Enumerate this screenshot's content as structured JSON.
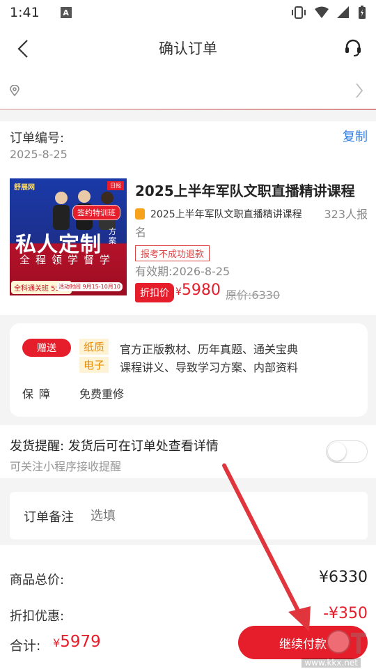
{
  "status_bar": {
    "time": "1:41",
    "notification": "A"
  },
  "nav": {
    "title": "确认订单"
  },
  "order": {
    "number_label": "订单编号:",
    "date": "2025-8-25",
    "copy_label": "复制"
  },
  "product": {
    "title": "2025上半年军队文职直播精讲课程",
    "name": "2025上半年军队文职直播精讲课程",
    "name_continued": "名",
    "enrolled": "323人报",
    "refund_tag": "报考不成功退款",
    "validity": "有效期:2026-8-25",
    "discount_label": "折扣价",
    "currency": "¥",
    "price": "5980",
    "original_price": "原价:6330",
    "thumb": {
      "brand": "舒展网",
      "tag": "日报",
      "badge": "签约特训班",
      "big_text": "私人定制",
      "side_text": "方案",
      "sub_text": "全程领学督学",
      "price_box": "全科通关班 5598",
      "date_text": "活动时间 9月15-10月10"
    }
  },
  "gift": {
    "badge": "赠送",
    "items": [
      {
        "kind": "纸质",
        "text": "官方正版教材、历年真题、通关宝典"
      },
      {
        "kind": "电子",
        "text": "课程讲义、导致学习方案、内部资料"
      }
    ],
    "guarantee_label": "保障",
    "guarantee_value": "免费重修"
  },
  "reminder": {
    "title": "发货提醒: 发货后可在订单处查看详情",
    "subtitle": "可关注小程序接收提醒",
    "enabled": false
  },
  "note": {
    "label": "订单备注",
    "placeholder": "选填"
  },
  "prices": {
    "total_label": "商品总价:",
    "total_value": "¥6330",
    "discount_label": "折扣优惠:",
    "discount_value": "-¥350"
  },
  "bottom": {
    "sum_label": "合计:",
    "currency": "¥",
    "sum_value": "5979",
    "pay_button": "继续付款"
  },
  "watermark": {
    "url": "www.kkx.net"
  },
  "colors": {
    "accent": "#e61e2b",
    "link": "#2f7de1",
    "gift_kind_bg": "#fff3d6",
    "gift_kind_text": "#e88b00"
  }
}
